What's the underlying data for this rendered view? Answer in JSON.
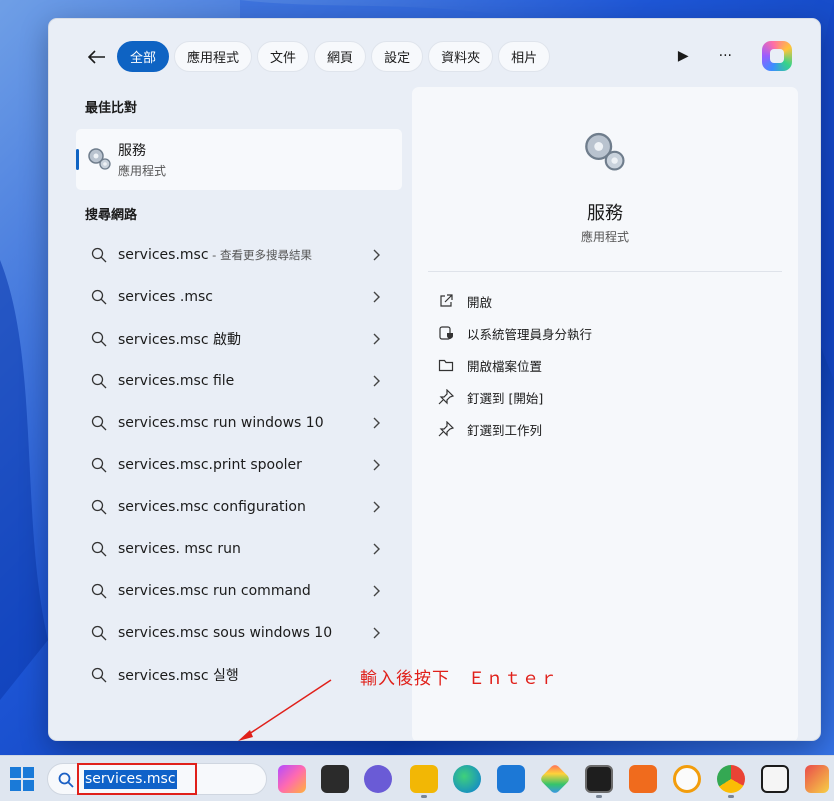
{
  "filters": {
    "back_label": "←",
    "chips": [
      "全部",
      "應用程式",
      "文件",
      "網頁",
      "設定",
      "資料夾",
      "相片"
    ],
    "play_label": "▶",
    "more_label": "···"
  },
  "best_match": {
    "heading": "最佳比對",
    "name": "服務",
    "type": "應用程式"
  },
  "web": {
    "heading": "搜尋網路",
    "results": [
      {
        "text": "services.msc",
        "sub": " - 查看更多搜尋結果"
      },
      {
        "text": "services .msc",
        "sub": ""
      },
      {
        "text": "services.msc 啟動",
        "sub": ""
      },
      {
        "text": "services.msc file",
        "sub": ""
      },
      {
        "text": "services.msc run windows 10",
        "sub": ""
      },
      {
        "text": "services.msc.print spooler",
        "sub": ""
      },
      {
        "text": "services.msc configuration",
        "sub": ""
      },
      {
        "text": "services. msc run",
        "sub": ""
      },
      {
        "text": "services.msc run command",
        "sub": ""
      },
      {
        "text": "services.msc sous windows 10",
        "sub": ""
      },
      {
        "text": "services.msc 실행",
        "sub": ""
      }
    ]
  },
  "preview": {
    "title": "服務",
    "subtitle": "應用程式",
    "actions": [
      "開啟",
      "以系統管理員身分執行",
      "開啟檔案位置",
      "釘選到 [開始]",
      "釘選到工作列"
    ]
  },
  "annotation": "輸入後按下　Ｅｎｔｅｒ",
  "taskbar": {
    "search_query": "services.msc"
  },
  "colors": {
    "accent": "#0e63c3",
    "annotation_red": "#e0201a"
  }
}
